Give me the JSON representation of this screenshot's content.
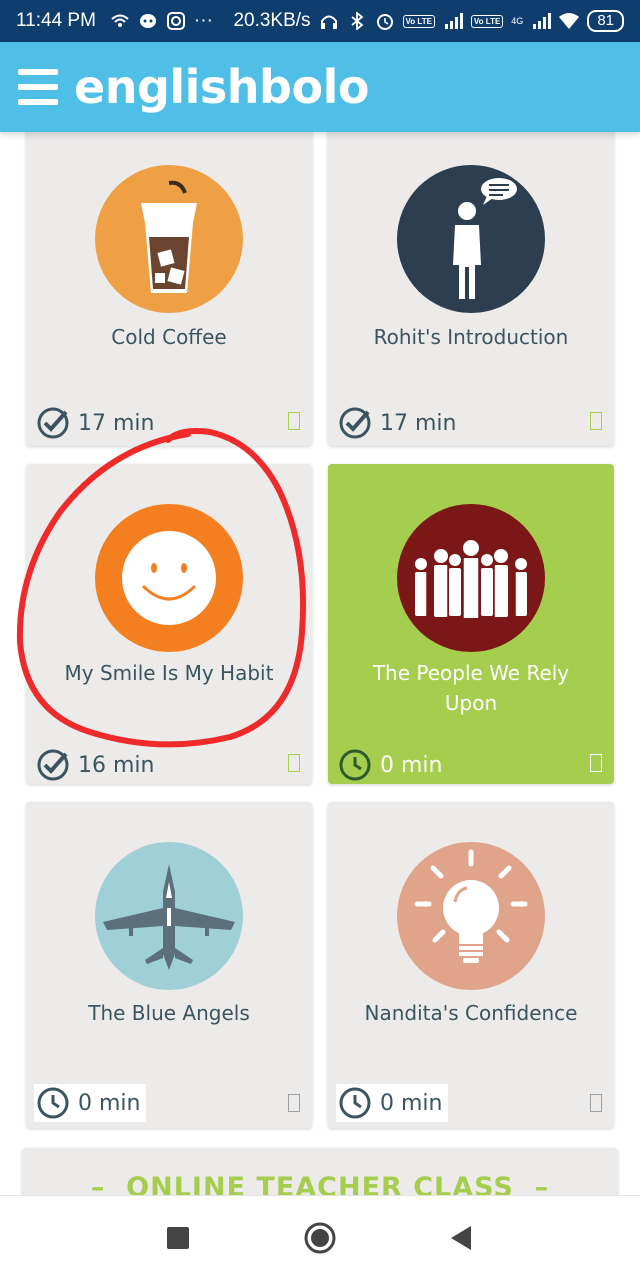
{
  "status_bar": {
    "time": "11:44 PM",
    "network_speed": "20.3KB/s",
    "battery": "81",
    "lte_badge": "Vo LTE",
    "signal_badge": "4G"
  },
  "app": {
    "logo_text": "englishbolo",
    "accent_color": "#4fbfe8",
    "green_color": "#a5cd4e"
  },
  "lessons": [
    {
      "title": "Cold Coffee",
      "duration": "17 min",
      "status": "completed",
      "icon": "cold-coffee-icon",
      "circle_color": "#f0a044"
    },
    {
      "title": "Rohit's Introduction",
      "duration": "17 min",
      "status": "completed",
      "icon": "speaking-person-icon",
      "circle_color": "#2c3e50"
    },
    {
      "title": "My Smile Is My Habit",
      "duration": "16 min",
      "status": "completed",
      "icon": "smiley-face-icon",
      "circle_color": "#f47f21"
    },
    {
      "title": "The People We Rely Upon",
      "duration": "0 min",
      "status": "current",
      "icon": "group-of-people-icon",
      "circle_color": "#7b1716"
    },
    {
      "title": "The Blue Angels",
      "duration": "0 min",
      "status": "locked",
      "icon": "fighter-jet-icon",
      "circle_color": "#9fd0d8"
    },
    {
      "title": "Nandita's Confidence",
      "duration": "0 min",
      "status": "locked",
      "icon": "light-bulb-icon",
      "circle_color": "#e0a48a"
    }
  ],
  "online_class": {
    "title": "ONLINE TEACHER CLASS"
  },
  "annotation_color": "#ee2a2a"
}
